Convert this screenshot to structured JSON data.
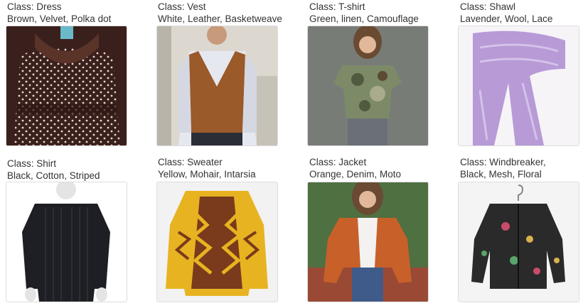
{
  "items": [
    {
      "class_line": "Class: Dress",
      "attr_line": "Brown, Velvet, Polka dot",
      "image_subject": "brown velvet polka dot dress",
      "main_color": "#4a2a24"
    },
    {
      "class_line": "Class: Vest",
      "attr_line": "White, Leather, Basketweave",
      "image_subject": "man in brown basketweave vest over shirt",
      "main_color": "#9a5a2a"
    },
    {
      "class_line": "Class: T-shirt",
      "attr_line": "Green, linen, Camouflage",
      "image_subject": "woman in camouflage t-shirt",
      "main_color": "#7d8a68"
    },
    {
      "class_line": "Class: Shawl",
      "attr_line": "Lavender, Wool, Lace",
      "image_subject": "lavender lace shawl",
      "main_color": "#b79ad6"
    },
    {
      "class_line": "Class: Shirt",
      "attr_line": "Black, Cotton, Striped",
      "image_subject": "black striped shirt on mannequin",
      "main_color": "#1e1f24"
    },
    {
      "class_line": "Class: Sweater",
      "attr_line": "Yellow, Mohair, Intarsia",
      "image_subject": "yellow and brown mohair intarsia sweater",
      "main_color": "#e7b321"
    },
    {
      "class_line": "Class: Jacket",
      "attr_line": "Orange, Denim, Moto",
      "image_subject": "woman in orange moto jacket",
      "main_color": "#c8602a"
    },
    {
      "class_line": "Class: Windbreaker,",
      "attr_line": "Black, Mesh, Floral",
      "image_subject": "black floral mesh windbreaker on hanger",
      "main_color": "#2a2a2a"
    }
  ]
}
